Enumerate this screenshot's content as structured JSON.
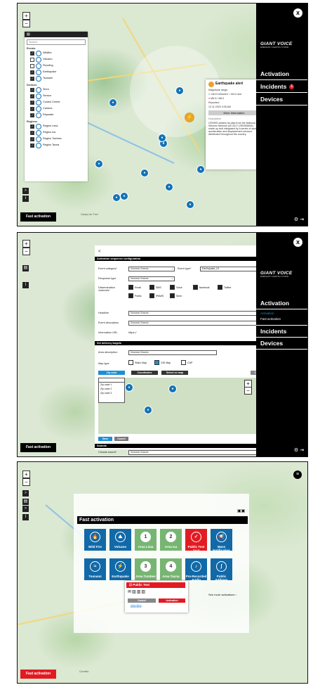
{
  "brand": {
    "name": "GIANT VOICE",
    "tag": "EMERGENCY ALERTING SYSTEM"
  },
  "nav": {
    "activation": "Activation",
    "incidents": "Incidents",
    "devices": "Devices",
    "fast_activation_sub": "Fast activation",
    "incident_count": "1"
  },
  "fast_activation": "Fast activation",
  "zoom": {
    "plus": "+",
    "minus": "−"
  },
  "close": "x",
  "map_labels": {
    "town1": "Campo de' Fiori",
    "town2": "Cornelia",
    "town3": "Casale"
  },
  "filter": {
    "search": "Search",
    "sections": {
      "events": "Events",
      "devices": "Devices",
      "regions": "Regions"
    },
    "events": [
      "Wildfire",
      "Volcano",
      "Flooding",
      "Earthquake",
      "Tsunami"
    ],
    "devices": [
      "Siren",
      "Sensor",
      "Control Center",
      "Camera",
      "Repeater"
    ],
    "regions": [
      "Region Lima",
      "Region Ica",
      "Region Tumbes",
      "Region Tacna"
    ]
  },
  "alert": {
    "title": "Earthquake alert",
    "range_label": "Magnitude range",
    "range_a": "<M4.0 between",
    "range_b": "M4.0 and",
    "range_c": "M6.0> M6.0",
    "reported_label": "Reported:",
    "reported": "12.11.2020 3:05 AM",
    "more": "More information",
    "desc_label": "Description",
    "desc": "CENSIS obtains its data from the National Seismic Network (IZI 0017 (SENSMAM) made up and integrated by a series of speed, acceleration and displacement sensors distributed throughout the country."
  },
  "form": {
    "back": "<",
    "section1": "Activation sequence configuration",
    "event_category_label": "Event category*",
    "event_category": "Xxxxxxx Xxxxxx",
    "event_type_label": "Event type*",
    "event_type": "Earthquake_01",
    "response_type_label": "Response type",
    "response_type": "Xxxxxxx Xxxxxx",
    "channels_label": "Dissemination channels*",
    "channels": [
      "Email",
      "SMS",
      "Voice",
      "facebook",
      "Twitter",
      "Public",
      "IPAWS",
      "Siren"
    ],
    "headline_label": "Headline",
    "headline": "Xxxxxxx Xxxxxx",
    "event_desc_label": "Event description",
    "event_desc": "Xxxxxxx Xxxxxx",
    "info_url_label": "Information URL",
    "info_url": "https://",
    "section2": "Set delivery targets",
    "area_desc_label": "Area description",
    "area_desc": "Xxxxxxx Xxxxxx",
    "map_type_label": "Map type",
    "map_types": [
      "Static Map",
      "GIS Map",
      "CAP"
    ],
    "tab_zip": "Zip code",
    "tab_coords": "Coordinates",
    "tab_select": "Select on map",
    "clear": "Clear",
    "zip_items": [
      "Zip code 1",
      "Zip code 2",
      "Zip code 3"
    ],
    "save": "Save",
    "cancel": "Cancel",
    "section3": "Sounds",
    "sound_label": "Choose sound*",
    "sound": "Xxxxxxx Xxxxxx"
  },
  "tiles": [
    {
      "label": "Wild Fire",
      "sym": "🔥",
      "color": "#1169a8",
      "kind": "b"
    },
    {
      "label": "Volcano",
      "sym": "⛰",
      "color": "#1169a8",
      "kind": "b"
    },
    {
      "label": "Area Lima",
      "sym": "1",
      "color": "#77b573",
      "kind": "g"
    },
    {
      "label": "Area Ica",
      "sym": "2",
      "color": "#77b573",
      "kind": "g"
    },
    {
      "label": "Public Test",
      "sym": "✓",
      "color": "#e21b23",
      "kind": "r",
      "sub": "Test all"
    },
    {
      "label": "Mass Notification",
      "sym": "📢",
      "color": "#1169a8",
      "kind": "b"
    },
    {
      "label": "Tsunami",
      "sym": "≈",
      "color": "#1169a8",
      "kind": "b"
    },
    {
      "label": "Earthquake",
      "sym": "⚡",
      "color": "#1169a8",
      "kind": "b"
    },
    {
      "label": "Area Tumbes",
      "sym": "3",
      "color": "#77b573",
      "kind": "g"
    },
    {
      "label": "Area Tacna",
      "sym": "4",
      "color": "#77b573",
      "kind": "g"
    },
    {
      "label": "Pre-Recorded Audio",
      "sym": "♪",
      "color": "#1169a8",
      "kind": "b"
    },
    {
      "label": "Public Address",
      "sym": "∫",
      "color": "#1169a8",
      "kind": "b"
    }
  ],
  "see_more": "See more activations",
  "popup": {
    "title": "Public Test",
    "cancel": "Cancel",
    "activate": "Activation"
  },
  "colors": {
    "accent_red": "#e21b23",
    "blue": "#1169a8",
    "green": "#77b573",
    "black": "#000000"
  }
}
